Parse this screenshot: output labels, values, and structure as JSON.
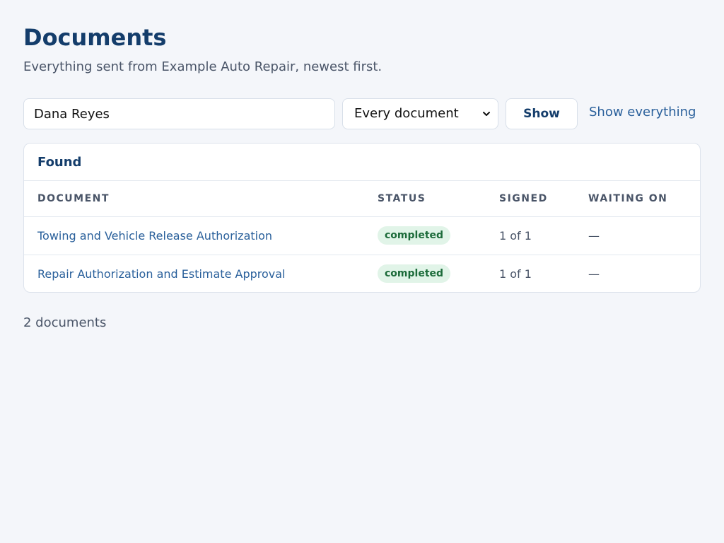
{
  "header": {
    "title": "Documents",
    "subtitle": "Everything sent from Example Auto Repair, newest first."
  },
  "filters": {
    "search_value": "Dana Reyes",
    "type_selected": "Every document",
    "show_label": "Show",
    "show_all_label": "Show everything"
  },
  "results": {
    "heading": "Found",
    "columns": [
      "DOCUMENT",
      "STATUS",
      "SIGNED",
      "WAITING ON"
    ],
    "rows": [
      {
        "document": "Towing and Vehicle Release Authorization",
        "status": "completed",
        "signed": "1 of 1",
        "waiting_on": "—"
      },
      {
        "document": "Repair Authorization and Estimate Approval",
        "status": "completed",
        "signed": "1 of 1",
        "waiting_on": "—"
      }
    ],
    "count_text": "2 documents"
  },
  "colors": {
    "title": "#143d6b",
    "link": "#2a609b",
    "badge_bg": "#e1f4e8",
    "badge_text": "#1c6b3a",
    "background": "#f4f6fa"
  },
  "icons": {
    "select_chevron": "chevron-down-icon"
  }
}
